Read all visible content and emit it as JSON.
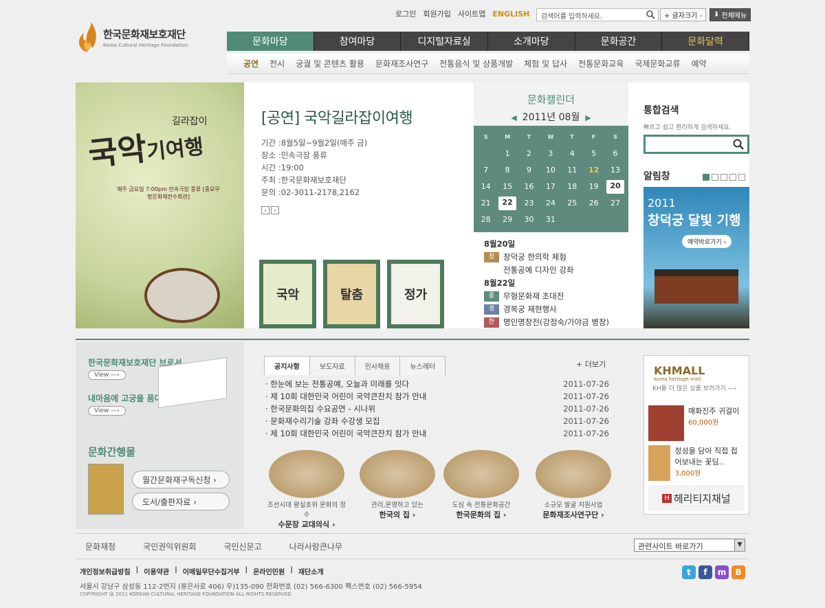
{
  "header": {
    "logo_ko": "한국문화재보호재단",
    "logo_en": "Korea Cultural Heritage Foundation",
    "util": [
      "로그인",
      "회원가입",
      "사이트맵",
      "ENGLISH"
    ],
    "search_placeholder": "검색어를 입력하세요.",
    "font_btn": "+ 글자크기 -",
    "all_menu": "전체메뉴"
  },
  "gnb": [
    "문화마당",
    "참여마당",
    "디지털자료실",
    "소개마당",
    "문화공간",
    "문화달력"
  ],
  "lnb": [
    "공연",
    "전시",
    "궁궐 및 콘텐츠 활용",
    "문화재조사연구",
    "전통음식 및 상품개발",
    "체험 및 답사",
    "전통문화교육",
    "국제문화교류",
    "예약"
  ],
  "event": {
    "title": "[공연] 국악길라잡이여행",
    "info": [
      "기간 :8월5일~9월2일(매주 금)",
      "장소 :민속극장 풍류",
      "시간 :19:00",
      "주최 :한국문화재보호재단",
      "문의 :02-3011-2178,2162"
    ],
    "poster_title": "국악",
    "poster_sub": "길라잡이",
    "poster_tail": "기여행",
    "poster_time": "매주 금요일 7:00pm 민속극장 풍류 [중요무형문화재전수회관]"
  },
  "thumbs": [
    "국악",
    "탈춤",
    "정가"
  ],
  "calendar": {
    "title": "문화캘린더",
    "month": "2011년 08월",
    "dows": [
      "S",
      "M",
      "T",
      "W",
      "T",
      "F",
      "S"
    ],
    "weeks": [
      [
        "",
        "1",
        "2",
        "3",
        "4",
        "5",
        "6"
      ],
      [
        "7",
        "8",
        "9",
        "10",
        "11",
        "12",
        "13"
      ],
      [
        "14",
        "15",
        "16",
        "17",
        "18",
        "19",
        "20"
      ],
      [
        "21",
        "22",
        "23",
        "24",
        "25",
        "26",
        "27"
      ],
      [
        "28",
        "29",
        "30",
        "31",
        "",
        "",
        ""
      ]
    ],
    "events": [
      {
        "date": "8월20일",
        "items": [
          {
            "tag": "창",
            "color": "#b58a4e",
            "text": "창덕궁 한의학 체험"
          },
          {
            "tag": "",
            "color": "",
            "text": "전통공예 디자인 강좌"
          }
        ]
      },
      {
        "date": "8월22일",
        "items": [
          {
            "tag": "중",
            "color": "#5e8b7d",
            "text": "무형문화재 초대전"
          },
          {
            "tag": "경",
            "color": "#6d7fa6",
            "text": "경복궁 재현행사"
          },
          {
            "tag": "한",
            "color": "#b25a5a",
            "text": "명인명창전(강정숙/가야금 병창)"
          }
        ]
      }
    ]
  },
  "right": {
    "search_title": "통합검색",
    "search_desc": "빠르고 쉽고 편리하게 검색하세요.",
    "notice_title": "알림창",
    "banner_year": "2011",
    "banner_title": "창덕궁 달빛 기행",
    "banner_btn": "예약바로가기 ›"
  },
  "left_low": {
    "brochure": "한국문화재보호재단 브로셔",
    "view": "View ―›",
    "story": "내마음에 고궁을 품다",
    "pub_title": "문화간행물",
    "pub_btn1": "월간문화재구독신청 ›",
    "pub_btn2": "도서/출판자료 ›"
  },
  "tabs": [
    "공지사항",
    "보도자료",
    "인사채용",
    "뉴스레터"
  ],
  "more": "+ 더보기",
  "news": [
    {
      "t": "한눈에 보는 전통공예, 오늘과 미래를 잇다",
      "d": "2011-07-26"
    },
    {
      "t": "제 10회 대한민국 어린이 국악큰잔치 참가 안내",
      "d": "2011-07-26"
    },
    {
      "t": "한국문화의집 수요공연 - 시나위",
      "d": "2011-07-26"
    },
    {
      "t": "문화재수리기술 강좌 수강생 모집",
      "d": "2011-07-26"
    },
    {
      "t": "제 10회 대한민국 어린이 국악큰잔치 참가 안내",
      "d": "2011-07-26"
    }
  ],
  "promos": [
    {
      "s": "조선시대 왕실호위 문화의 정수",
      "b": "수문장 교대의식 ›"
    },
    {
      "s": "관리,운영하고 있는",
      "b": "한국의 집 ›"
    },
    {
      "s": "도심 속 전통문화공간",
      "b": "한국문화의 집 ›"
    },
    {
      "s": "소규모 발굴 지원사업",
      "b": "문화재조사연구단 ›"
    }
  ],
  "mall": {
    "logo": "KHMALL",
    "logo_sub": "korea heritage mall",
    "link": "KH몰 더 많은 상품 보러가기 ―›",
    "items": [
      {
        "n": "매화진주 귀걸이",
        "p": "60,000원"
      },
      {
        "n": "정성을 담아 직접 접어보내는 꽃딤..",
        "p": "3,000원"
      }
    ],
    "channel": "헤리티지채널"
  },
  "orgs": [
    "문화재청",
    "국민권익위원회",
    "국민신문고",
    "나라사랑큰나무"
  ],
  "related": "관련사이트 바로가기",
  "footer": {
    "links": [
      "개인정보취급방침",
      "이용약관",
      "이메일무단수집거부",
      "온라인민원",
      "재단소개"
    ],
    "addr": "서울시 강남구 삼성동 112-2번지 (봉은사로 406)  우)135-090  전화번호 (02) 566-6300  팩스번호 (02) 566-5954",
    "copy": "COPYRIGHT @ 2011 KOREAN CULTURAL HERITAGE FOUNDATION  ALL RIGHTS RESERVED"
  },
  "sns": [
    {
      "n": "t",
      "c": "#3aa4d8"
    },
    {
      "n": "f",
      "c": "#3b5998"
    },
    {
      "n": "m",
      "c": "#8a4fc8"
    },
    {
      "n": "B",
      "c": "#f08a24"
    }
  ]
}
